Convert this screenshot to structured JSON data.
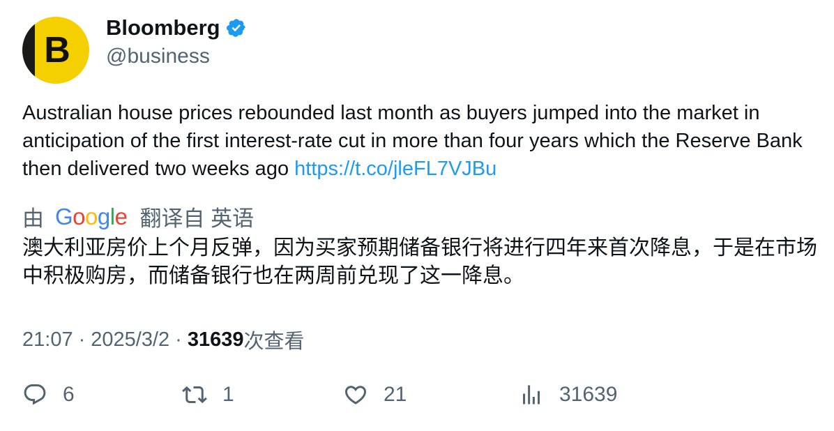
{
  "author": {
    "avatar_letter": "B",
    "display_name": "Bloomberg",
    "handle": "@business",
    "verified_color": "#1d9bf0",
    "avatar_color": "#f5d000"
  },
  "tweet": {
    "text": "Australian house prices rebounded last month as buyers jumped into the market in anticipation of the first interest-rate cut in more than four years which the Reserve Bank then delivered two weeks ago ",
    "link": "https://t.co/jleFL7VJBu"
  },
  "translation": {
    "prefix": "由",
    "provider": "Google",
    "suffix": "翻译自 英语",
    "text": "澳大利亚房价上个月反弹，因为买家预期储备银行将进行四年来首次降息，于是在市场中积极购房，而储备银行也在两周前兑现了这一降息。"
  },
  "meta": {
    "time": "21:07",
    "separator": "·",
    "date": "2025/3/2",
    "views": "31639",
    "views_suffix": "次查看"
  },
  "actions": {
    "replies": "6",
    "retweets": "1",
    "likes": "21",
    "views": "31639"
  },
  "icons": {
    "reply": "reply-icon",
    "retweet": "retweet-icon",
    "like": "heart-icon",
    "views": "analytics-icon",
    "verified": "verified-badge-icon"
  }
}
